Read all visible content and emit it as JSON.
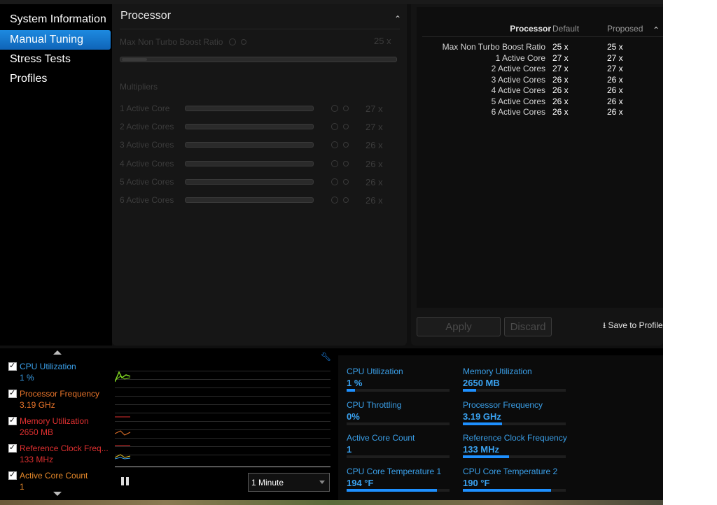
{
  "sidebar": {
    "items": [
      "System Information",
      "Manual Tuning",
      "Stress Tests",
      "Profiles"
    ]
  },
  "processor_panel": {
    "title": "Processor",
    "max_non_turbo": {
      "label": "Max Non Turbo Boost Ratio",
      "value": "25 x"
    },
    "multipliers_heading": "Multipliers",
    "rows": [
      {
        "label": "1 Active Core",
        "value": "27 x"
      },
      {
        "label": "2 Active Cores",
        "value": "27 x"
      },
      {
        "label": "3 Active Cores",
        "value": "26 x"
      },
      {
        "label": "4 Active Cores",
        "value": "26 x"
      },
      {
        "label": "5 Active Cores",
        "value": "26 x"
      },
      {
        "label": "6 Active Cores",
        "value": "26 x"
      }
    ]
  },
  "summary": {
    "headers": {
      "processor": "Processor",
      "default": "Default",
      "proposed": "Proposed"
    },
    "rows": [
      {
        "label": "Max Non Turbo Boost Ratio",
        "default": "25 x",
        "proposed": "25 x"
      },
      {
        "label": "1 Active Core",
        "default": "27 x",
        "proposed": "27 x"
      },
      {
        "label": "2 Active Cores",
        "default": "27 x",
        "proposed": "27 x"
      },
      {
        "label": "3 Active Cores",
        "default": "26 x",
        "proposed": "26 x"
      },
      {
        "label": "4 Active Cores",
        "default": "26 x",
        "proposed": "26 x"
      },
      {
        "label": "5 Active Cores",
        "default": "26 x",
        "proposed": "26 x"
      },
      {
        "label": "6 Active Cores",
        "default": "26 x",
        "proposed": "26 x"
      }
    ],
    "apply_label": "Apply",
    "discard_label": "Discard",
    "save_profile_label": "⭳ Save to Profile"
  },
  "monitor": {
    "items": [
      {
        "name": "CPU Utilization",
        "value": "1 %",
        "color": "#3a9fe8"
      },
      {
        "name": "Processor Frequency",
        "value": "3.19 GHz",
        "color": "#e8742a"
      },
      {
        "name": "Memory Utilization",
        "value": "2650  MB",
        "color": "#e03030"
      },
      {
        "name": "Reference Clock Freq...",
        "value": "133 MHz",
        "color": "#e03030"
      },
      {
        "name": "Active Core Count",
        "value": "1",
        "color": "#e88a2a"
      }
    ],
    "interval": "1 Minute"
  },
  "stats": [
    {
      "name": "CPU Utilization",
      "value": "1 %",
      "fill": 0.08
    },
    {
      "name": "Memory Utilization",
      "value": "2650  MB",
      "fill": 0.13
    },
    {
      "name": "CPU Throttling",
      "value": "0%",
      "fill": 0.0
    },
    {
      "name": "Processor Frequency",
      "value": "3.19 GHz",
      "fill": 0.38
    },
    {
      "name": "Active Core Count",
      "value": "1",
      "fill": 0.0
    },
    {
      "name": "Reference Clock Frequency",
      "value": "133 MHz",
      "fill": 0.45
    },
    {
      "name": "CPU Core Temperature 1",
      "value": "194 °F",
      "fill": 0.88
    },
    {
      "name": "CPU Core Temperature 2",
      "value": "190 °F",
      "fill": 0.86
    }
  ]
}
